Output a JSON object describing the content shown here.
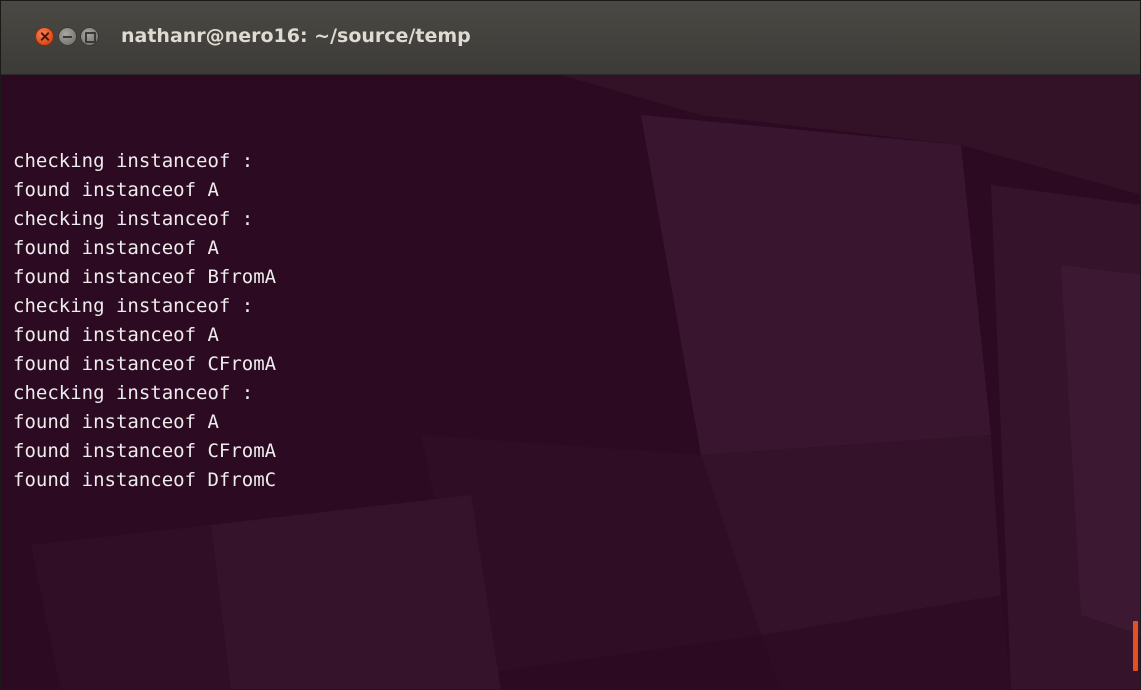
{
  "window": {
    "title": "nathanr@nero16: ~/source/temp",
    "accent_close_color": "#e2511f",
    "background_color": "#2c0a22"
  },
  "controls": {
    "close_icon": "close-icon",
    "minimize_icon": "minimize-icon",
    "maximize_icon": "maximize-icon"
  },
  "terminal": {
    "lines": [
      "checking instanceof :",
      "found instanceof A",
      "checking instanceof :",
      "found instanceof A",
      "found instanceof BfromA",
      "checking instanceof :",
      "found instanceof A",
      "found instanceof CFromA",
      "checking instanceof :",
      "found instanceof A",
      "found instanceof CFromA",
      "found instanceof DfromC"
    ]
  }
}
